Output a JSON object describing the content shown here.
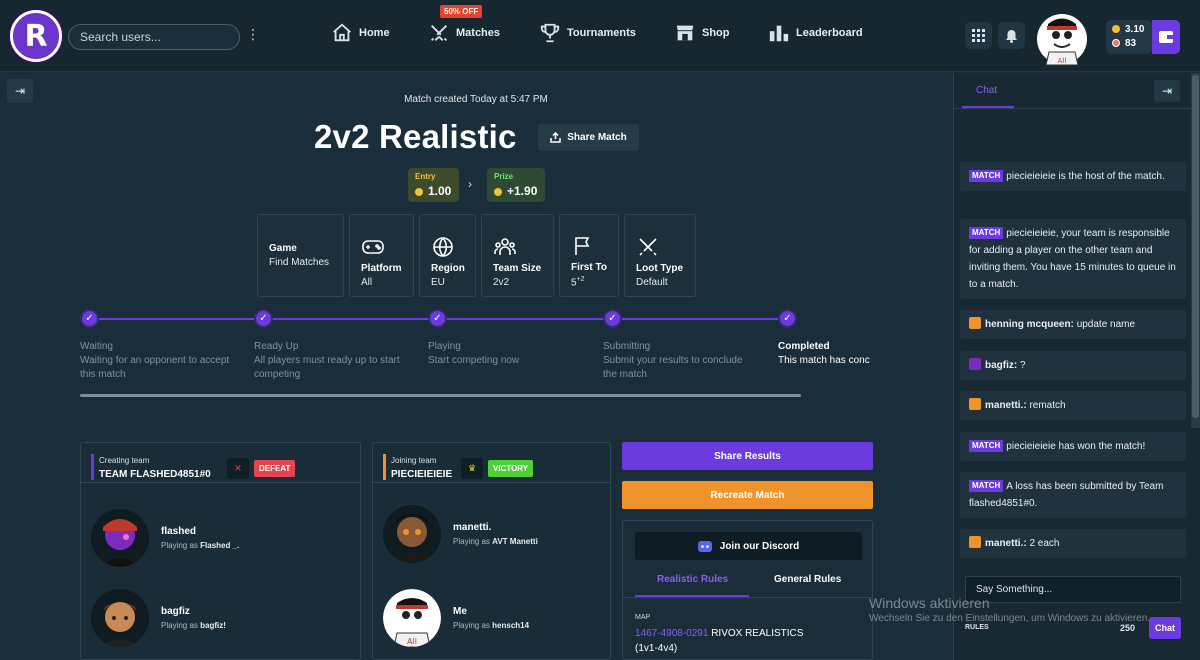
{
  "header": {
    "logo_letter": "R",
    "search_placeholder": "Search users...",
    "nav": [
      {
        "label": "Home",
        "icon": "home-icon"
      },
      {
        "label": "Matches",
        "icon": "swords-icon"
      },
      {
        "label": "Tournaments",
        "icon": "trophy-icon"
      },
      {
        "label": "Shop",
        "icon": "shop-icon"
      },
      {
        "label": "Leaderboard",
        "icon": "leaderboard-icon"
      }
    ],
    "promo_badge": "50% OFF",
    "balance_coins": "3.10",
    "balance_tokens": "83"
  },
  "match": {
    "created": "Match created Today at 5:47 PM",
    "title": "2v2 Realistic",
    "share_label": "Share Match",
    "entry_label": "Entry",
    "entry_value": "1.00",
    "prize_label": "Prize",
    "prize_value": "+1.90",
    "cards": [
      {
        "label": "Game",
        "value": "Find Matches",
        "icon": ""
      },
      {
        "label": "Platform",
        "value": "All",
        "icon": "gamepad-icon"
      },
      {
        "label": "Region",
        "value": "EU",
        "icon": "globe-icon"
      },
      {
        "label": "Team Size",
        "value": "2v2",
        "icon": "people-icon"
      },
      {
        "label": "First To",
        "value": "5",
        "value_sup": "+2",
        "icon": "flag-icon"
      },
      {
        "label": "Loot Type",
        "value": "Default",
        "icon": "swords-icon"
      }
    ],
    "steps": [
      {
        "title": "Waiting",
        "desc": "Waiting for an opponent to accept this match"
      },
      {
        "title": "Ready Up",
        "desc": "All players must ready up to start competing"
      },
      {
        "title": "Playing",
        "desc": "Start competing now"
      },
      {
        "title": "Submitting",
        "desc": "Submit your results to conclude the match"
      },
      {
        "title": "Completed",
        "desc": "This match has conc"
      }
    ]
  },
  "teams": {
    "creating": {
      "label": "Creating team",
      "name": "TEAM FLASHED4851#0",
      "result": "DEFEAT",
      "players": [
        {
          "name": "flashed",
          "playing_as_prefix": "Playing as",
          "playing_as": "Flashed _."
        },
        {
          "name": "bagfiz",
          "playing_as_prefix": "Playing as",
          "playing_as": "bagfiz!"
        }
      ]
    },
    "joining": {
      "label": "Joining team",
      "name": "PIECIEIEIEIE",
      "result": "VICTORY",
      "players": [
        {
          "name": "manetti.",
          "playing_as_prefix": "Playing as",
          "playing_as": "AVT Manetti"
        },
        {
          "name": "Me",
          "playing_as_prefix": "Playing as",
          "playing_as": "hensch14"
        }
      ]
    }
  },
  "actions": {
    "share_results": "Share Results",
    "recreate": "Recreate Match",
    "discord": "Join our Discord",
    "tab_realistic": "Realistic Rules",
    "tab_general": "General Rules",
    "map_label": "MAP",
    "map_code": "1467-4908-0291",
    "map_name": "RIVOX REALISTICS",
    "map_mode": "(1v1-4v4)"
  },
  "chat": {
    "tab": "Chat",
    "tag": "MATCH",
    "messages": [
      {
        "type": "match",
        "text": "piecieieieie is the host of the match."
      },
      {
        "type": "match",
        "text": "piecieieieie, your team is responsible for adding a player on the other team and inviting them. You have 15 minutes to queue in to a match."
      },
      {
        "type": "user",
        "user": "henning mcqueen:",
        "text": "update name"
      },
      {
        "type": "user",
        "user": "bagfiz:",
        "text": "?"
      },
      {
        "type": "user",
        "user": "manetti.:",
        "text": "rematch"
      },
      {
        "type": "match",
        "text": "piecieieieie has won the match!"
      },
      {
        "type": "match",
        "text": "A loss has been submitted by Team flashed4851#0."
      },
      {
        "type": "user",
        "user": "manetti.:",
        "text": "2 each"
      }
    ],
    "input_placeholder": "Say Something...",
    "rules_label": "RULES",
    "char_count": "250",
    "send_label": "Chat"
  },
  "watermark": {
    "line1": "Windows aktivieren",
    "line2": "Wechseln Sie zu den Einstellungen, um Windows zu aktivieren."
  },
  "colors": {
    "accent": "#6c3be0",
    "defeat": "#e5434d",
    "victory": "#4cd137",
    "recreate": "#f0932b"
  }
}
